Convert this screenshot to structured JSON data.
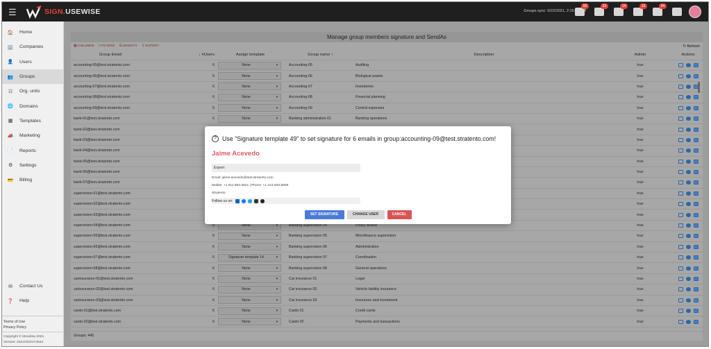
{
  "topbar": {
    "brand_a": "SIGN.",
    "brand_b": "USEWISE",
    "sync": "Groups sync: 5/22/2021, 2:15:26 PM",
    "badges": [
      "59",
      "93",
      "14",
      "10",
      "94"
    ]
  },
  "sidebar": {
    "items": [
      {
        "label": "Home",
        "icon": "home-icon"
      },
      {
        "label": "Companies",
        "icon": "companies-icon"
      },
      {
        "label": "Users",
        "icon": "users-icon"
      },
      {
        "label": "Groups",
        "icon": "groups-icon"
      },
      {
        "label": "Org. units",
        "icon": "org-units-icon"
      },
      {
        "label": "Domains",
        "icon": "globe-icon"
      },
      {
        "label": "Templates",
        "icon": "templates-icon"
      },
      {
        "label": "Marketing",
        "icon": "marketing-icon"
      },
      {
        "label": "Reports",
        "icon": "reports-icon"
      },
      {
        "label": "Settings",
        "icon": "gear-icon"
      },
      {
        "label": "Billing",
        "icon": "billing-icon"
      }
    ],
    "contact": "Contact Us",
    "help": "Help",
    "terms": "Terms of Use",
    "privacy": "Privacy Policy",
    "copyright": "Copyright © Moodina 2021.",
    "version": "Version: 20210322174544"
  },
  "main": {
    "title": "Manage group members signature and SendAs",
    "toolbar": {
      "columns": "COLUMNS",
      "filters": "FILTERS",
      "density": "DENSITY",
      "export": "EXPORT",
      "refresh": "Refresh"
    },
    "headers": {
      "email": "Group Email",
      "users": "#Users",
      "template": "Assign template",
      "gname": "Group name",
      "desc": "Description",
      "admin": "Admin",
      "actions": "Actions"
    },
    "rows": [
      {
        "email": "accounting-05@test.stratento.com",
        "users": "6",
        "tpl": "None",
        "gname": "Accounting-05",
        "desc": "Auditing",
        "admin": "true"
      },
      {
        "email": "accounting-06@test.stratento.com",
        "users": "6",
        "tpl": "None",
        "gname": "Accounting-06",
        "desc": "Biological assets",
        "admin": "true"
      },
      {
        "email": "accounting-07@test.stratento.com",
        "users": "6",
        "tpl": "None",
        "gname": "Accounting-07",
        "desc": "Inventories",
        "admin": "true"
      },
      {
        "email": "accounting-08@test.stratento.com",
        "users": "6",
        "tpl": "None",
        "gname": "Accounting-08",
        "desc": "Financial planning",
        "admin": "true"
      },
      {
        "email": "accounting-09@test.stratento.com",
        "users": "6",
        "tpl": "None",
        "gname": "Accounting-09",
        "desc": "Central expenses",
        "admin": "true"
      },
      {
        "email": "bank-01@test.stratento.com",
        "users": "6",
        "tpl": "None",
        "gname": "Banking administration 01",
        "desc": "Banking operations",
        "admin": "true"
      },
      {
        "email": "bank-02@test.stratento.com",
        "users": "6",
        "tpl": "",
        "gname": "",
        "desc": "",
        "admin": "true"
      },
      {
        "email": "bank-03@test.stratento.com",
        "users": "6",
        "tpl": "",
        "gname": "",
        "desc": "",
        "admin": "true"
      },
      {
        "email": "bank-04@test.stratento.com",
        "users": "6",
        "tpl": "",
        "gname": "",
        "desc": "",
        "admin": "true"
      },
      {
        "email": "bank-05@test.stratento.com",
        "users": "6",
        "tpl": "",
        "gname": "",
        "desc": "",
        "admin": "true"
      },
      {
        "email": "bank-06@test.stratento.com",
        "users": "6",
        "tpl": "",
        "gname": "",
        "desc": "",
        "admin": "true"
      },
      {
        "email": "bank-07@test.stratento.com",
        "users": "6",
        "tpl": "",
        "gname": "",
        "desc": "",
        "admin": "true"
      },
      {
        "email": "supervision-01@test.stratento.com",
        "users": "6",
        "tpl": "",
        "gname": "",
        "desc": "",
        "admin": "true"
      },
      {
        "email": "supervision-02@test.stratento.com",
        "users": "6",
        "tpl": "",
        "gname": "",
        "desc": "",
        "admin": "true"
      },
      {
        "email": "supervision-03@test.stratento.com",
        "users": "6",
        "tpl": "",
        "gname": "",
        "desc": "",
        "admin": "true"
      },
      {
        "email": "supervision-04@test.stratento.com",
        "users": "6",
        "tpl": "None",
        "gname": "Banking supervision 04",
        "desc": "Policy review",
        "admin": "true"
      },
      {
        "email": "supervision-05@test.stratento.com",
        "users": "6",
        "tpl": "None",
        "gname": "Banking supervision 05",
        "desc": "Microfinance supervision",
        "admin": "true"
      },
      {
        "email": "supervision-06@test.stratento.com",
        "users": "6",
        "tpl": "None",
        "gname": "Banking supervision 06",
        "desc": "Administration",
        "admin": "true"
      },
      {
        "email": "supervision-07@test.stratento.com",
        "users": "6",
        "tpl": "Signature template 14",
        "gname": "Banking supervision 07",
        "desc": "Coordination",
        "admin": "true"
      },
      {
        "email": "supervision-08@test.stratento.com",
        "users": "6",
        "tpl": "None",
        "gname": "Banking supervision 08",
        "desc": "General operations",
        "admin": "true"
      },
      {
        "email": "carinsurance-01@test.stratento.com",
        "users": "6",
        "tpl": "None",
        "gname": "Car insurance 01",
        "desc": "Legal",
        "admin": "true"
      },
      {
        "email": "carinsurance-02@test.stratento.com",
        "users": "6",
        "tpl": "None",
        "gname": "Car insurance 02",
        "desc": "Vehicle liability insurance",
        "admin": "true"
      },
      {
        "email": "carinsurance-03@test.stratento.com",
        "users": "6",
        "tpl": "None",
        "gname": "Car insurance 03",
        "desc": "Insurance and investment",
        "admin": "true"
      },
      {
        "email": "cards-01@test.stratento.com",
        "users": "6",
        "tpl": "None",
        "gname": "Cards 01",
        "desc": "Credit cards",
        "admin": "true"
      },
      {
        "email": "cards-02@test.stratento.com",
        "users": "6",
        "tpl": "None",
        "gname": "Cards 02",
        "desc": "Payments and transactions",
        "admin": "true"
      }
    ],
    "footer": "Groups: 445"
  },
  "modal": {
    "title": "Use \"Signature template 49\" to set signature for 6 emails in group:accounting-09@test.stratento.com!",
    "name": "Jaime Acevedo",
    "role": "Expert",
    "email_line": "Email: jaime.acevedo@test.stratento.com",
    "phone_line": "Mobile: +1 511-653-3621 | Phone: +1 212-933-6568",
    "company": "Stratento",
    "follow": "Follow us on:",
    "btn_set": "SET SIGNATURE",
    "btn_change": "CHANGE USER",
    "btn_cancel": "CANCEL"
  }
}
